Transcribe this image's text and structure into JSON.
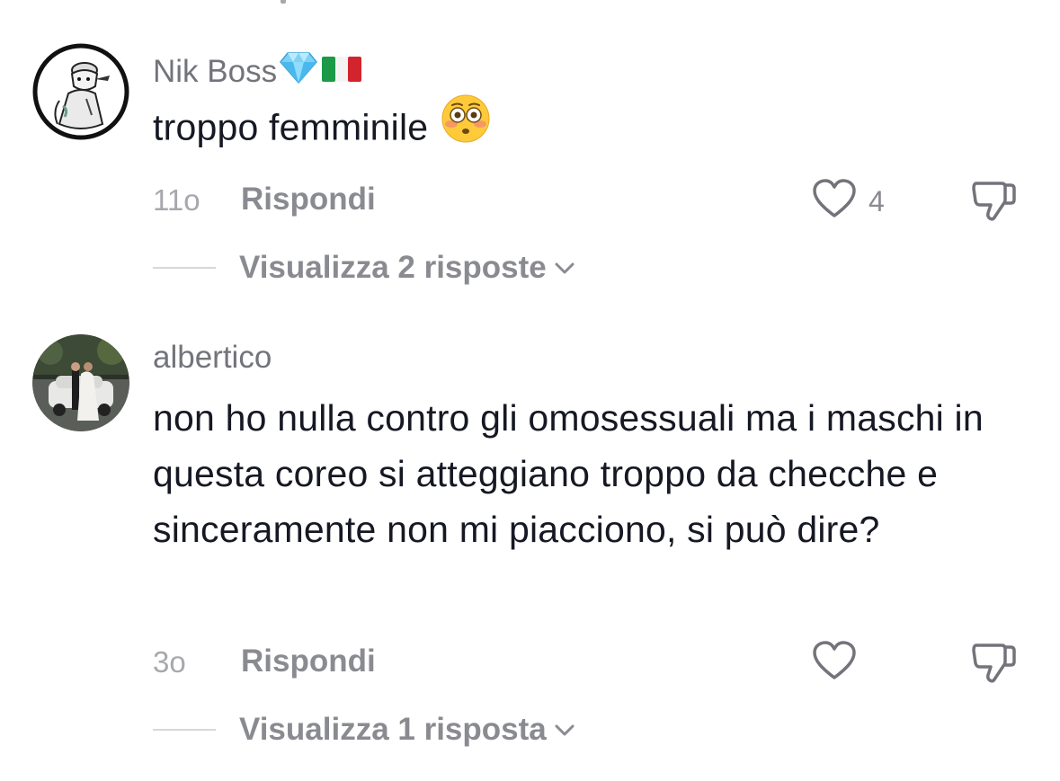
{
  "comments": [
    {
      "username": "Nik Boss",
      "username_badges": [
        "diamond-icon",
        "italy-flag-icon"
      ],
      "text": "troppo femminile",
      "emoji": "flushed-face-emoji",
      "time": "11o",
      "reply_label": "Rispondi",
      "like_count": "4",
      "replies_label": "Visualizza 2 risposte"
    },
    {
      "username": "albertico",
      "text": "non ho nulla contro gli omosessuali ma i maschi in questa coreo si atteggiano troppo da checche e sinceramente non mi piacciono, si può dire?",
      "time": "3o",
      "reply_label": "Rispondi",
      "like_count": "",
      "replies_label": "Visualizza 1 risposta"
    }
  ],
  "colors": {
    "primary_text": "#161823",
    "secondary_text": "#8a8b91",
    "muted_text": "#a7a8ad",
    "icon": "#73747b"
  }
}
